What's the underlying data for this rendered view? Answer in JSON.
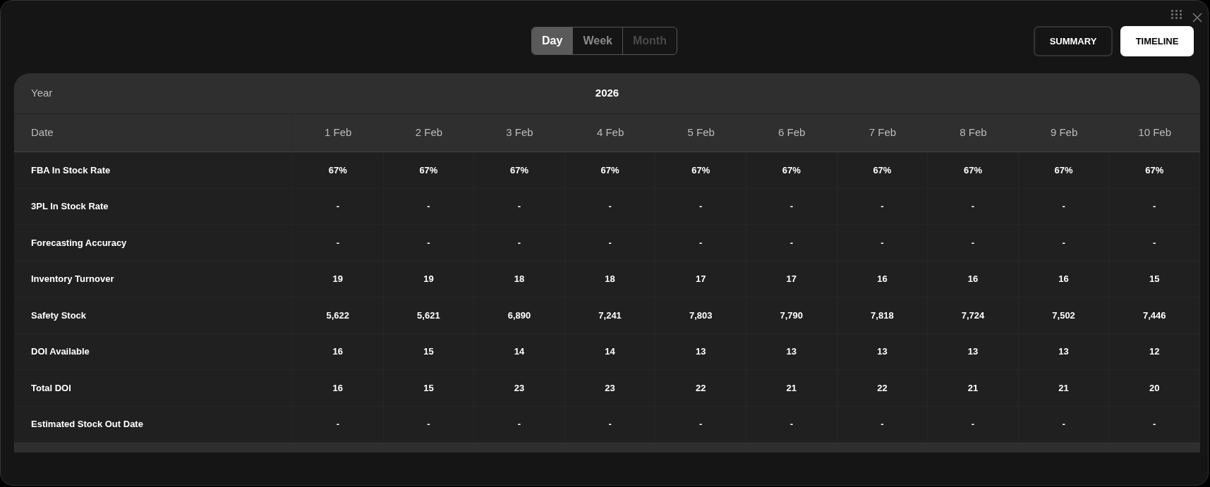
{
  "period_toggle": [
    {
      "label": "Day",
      "selected": true,
      "disabled": false
    },
    {
      "label": "Week",
      "selected": false,
      "disabled": false
    },
    {
      "label": "Month",
      "selected": false,
      "disabled": true
    }
  ],
  "view_buttons": [
    {
      "label": "SUMMARY",
      "selected": false
    },
    {
      "label": "TIMELINE",
      "selected": true
    }
  ],
  "table": {
    "year_label": "Year",
    "year": "2026",
    "date_label": "Date",
    "dates": [
      "1 Feb",
      "2 Feb",
      "3 Feb",
      "4 Feb",
      "5 Feb",
      "6 Feb",
      "7 Feb",
      "8 Feb",
      "9 Feb",
      "10 Feb"
    ],
    "rows": [
      {
        "label": "FBA In Stock Rate",
        "values": [
          "67%",
          "67%",
          "67%",
          "67%",
          "67%",
          "67%",
          "67%",
          "67%",
          "67%",
          "67%"
        ]
      },
      {
        "label": "3PL In Stock Rate",
        "values": [
          "-",
          "-",
          "-",
          "-",
          "-",
          "-",
          "-",
          "-",
          "-",
          "-"
        ]
      },
      {
        "label": "Forecasting Accuracy",
        "values": [
          "-",
          "-",
          "-",
          "-",
          "-",
          "-",
          "-",
          "-",
          "-",
          "-"
        ]
      },
      {
        "label": "Inventory Turnover",
        "values": [
          "19",
          "19",
          "18",
          "18",
          "17",
          "17",
          "16",
          "16",
          "16",
          "15"
        ]
      },
      {
        "label": "Safety Stock",
        "values": [
          "5,622",
          "5,621",
          "6,890",
          "7,241",
          "7,803",
          "7,790",
          "7,818",
          "7,724",
          "7,502",
          "7,446"
        ]
      },
      {
        "label": "DOI Available",
        "values": [
          "16",
          "15",
          "14",
          "14",
          "13",
          "13",
          "13",
          "13",
          "13",
          "12"
        ]
      },
      {
        "label": "Total DOI",
        "values": [
          "16",
          "15",
          "23",
          "23",
          "22",
          "21",
          "22",
          "21",
          "21",
          "20"
        ]
      },
      {
        "label": "Estimated Stock Out Date",
        "values": [
          "-",
          "-",
          "-",
          "-",
          "-",
          "-",
          "-",
          "-",
          "-",
          "-"
        ]
      }
    ]
  }
}
